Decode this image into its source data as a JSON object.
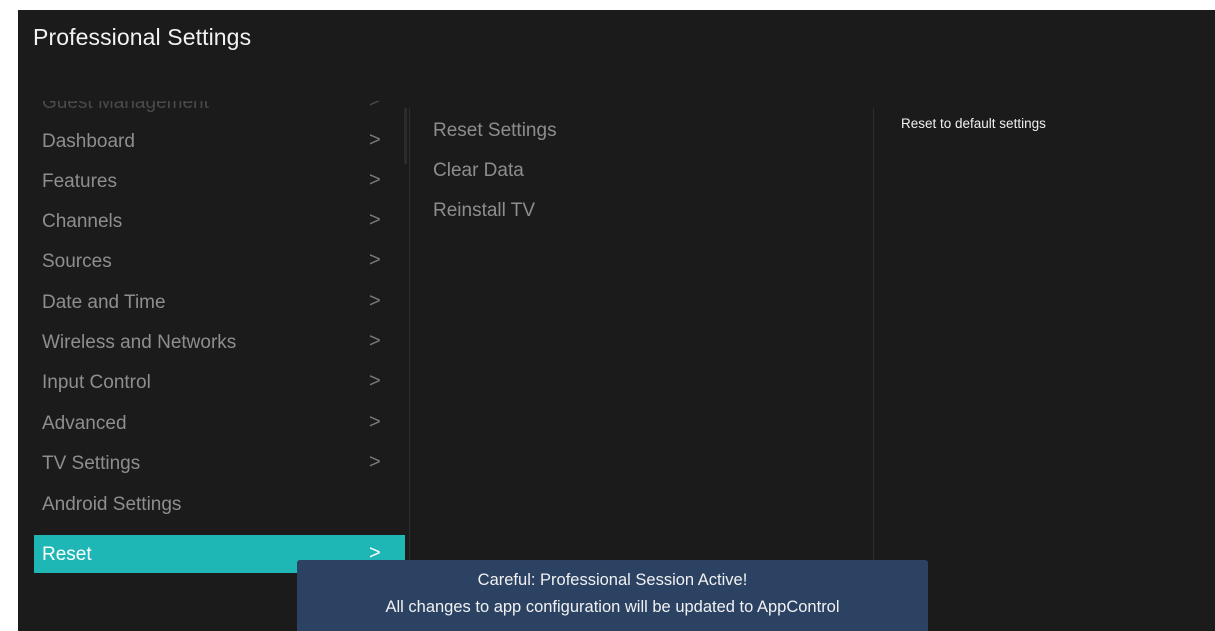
{
  "header": {
    "title": "Professional Settings"
  },
  "sidebar": {
    "items": [
      {
        "label": "Guest Management",
        "chevron": ">",
        "state": "faded"
      },
      {
        "label": "Dashboard",
        "chevron": ">",
        "state": "normal"
      },
      {
        "label": "Features",
        "chevron": ">",
        "state": "normal"
      },
      {
        "label": "Channels",
        "chevron": ">",
        "state": "normal"
      },
      {
        "label": "Sources",
        "chevron": ">",
        "state": "normal"
      },
      {
        "label": "Date and Time",
        "chevron": ">",
        "state": "normal"
      },
      {
        "label": "Wireless and Networks",
        "chevron": ">",
        "state": "normal"
      },
      {
        "label": "Input Control",
        "chevron": ">",
        "state": "normal"
      },
      {
        "label": "Advanced",
        "chevron": ">",
        "state": "normal"
      },
      {
        "label": "TV Settings",
        "chevron": ">",
        "state": "normal"
      },
      {
        "label": "Android Settings",
        "chevron": "",
        "state": "normal"
      },
      {
        "label": "Reset",
        "chevron": ">",
        "state": "selected"
      }
    ]
  },
  "submenu": {
    "options": [
      {
        "label": "Reset Settings"
      },
      {
        "label": "Clear Data"
      },
      {
        "label": "Reinstall TV"
      }
    ]
  },
  "details": {
    "description": "Reset to default settings"
  },
  "toast": {
    "line1": "Careful: Professional Session Active!",
    "line2": "All changes to app configuration will be updated to AppControl"
  },
  "colors": {
    "background": "#1b1b1b",
    "selected_accent": "#1fb6b6",
    "toast_background": "#2b4263",
    "menu_text": "#8e8e8e"
  },
  "icons": {
    "chevron": "chevron-right-icon"
  }
}
